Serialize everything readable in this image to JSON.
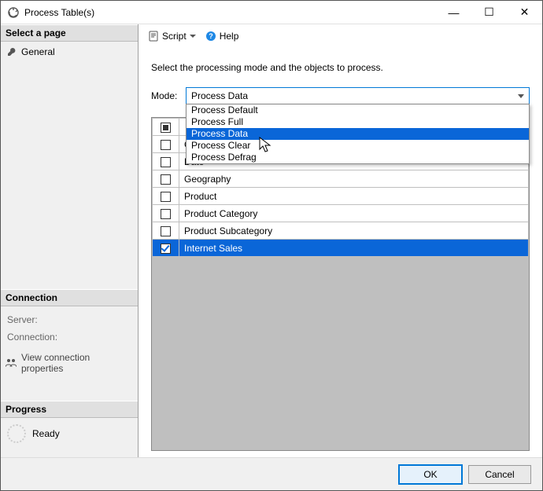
{
  "window": {
    "title": "Process Table(s)"
  },
  "winbuttons": {
    "min": "—",
    "max": "☐",
    "close": "✕"
  },
  "sidebar": {
    "select_page": "Select a page",
    "pages": [
      {
        "label": "General"
      }
    ],
    "connection_head": "Connection",
    "server_label": "Server:",
    "connection_label": "Connection:",
    "view_props": "View connection properties",
    "progress_head": "Progress",
    "progress_status": "Ready"
  },
  "toolbar": {
    "script": "Script",
    "help": "Help"
  },
  "main": {
    "instruction": "Select the processing mode and the objects to process.",
    "mode_label": "Mode:",
    "mode_value": "Process Data",
    "mode_options": [
      "Process Default",
      "Process Full",
      "Process Data",
      "Process Clear",
      "Process Defrag"
    ],
    "rows": [
      {
        "name": "Customer",
        "checked": false
      },
      {
        "name": "Date",
        "checked": false
      },
      {
        "name": "Geography",
        "checked": false
      },
      {
        "name": "Product",
        "checked": false
      },
      {
        "name": "Product Category",
        "checked": false
      },
      {
        "name": "Product Subcategory",
        "checked": false
      },
      {
        "name": "Internet Sales",
        "checked": true,
        "selected": true
      }
    ]
  },
  "footer": {
    "ok": "OK",
    "cancel": "Cancel"
  }
}
